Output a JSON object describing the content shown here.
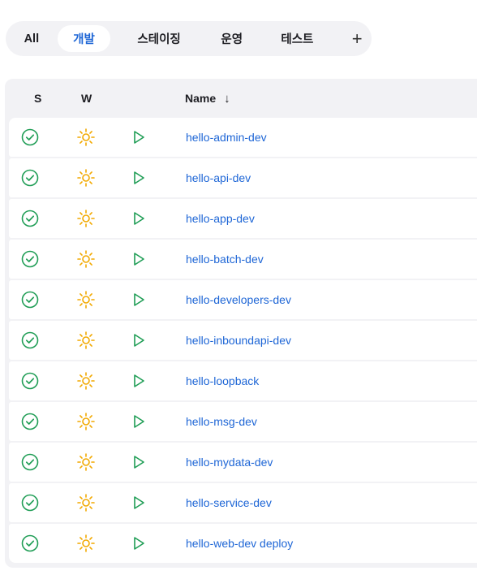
{
  "tabs": [
    {
      "label": "All",
      "active": false
    },
    {
      "label": "개발",
      "active": true
    },
    {
      "label": "스테이징",
      "active": false
    },
    {
      "label": "운영",
      "active": false
    },
    {
      "label": "테스트",
      "active": false
    }
  ],
  "add_tab_label": "+",
  "table": {
    "headers": {
      "status": "S",
      "weather": "W",
      "name": "Name",
      "sort": "↓"
    },
    "rows": [
      {
        "name": "hello-admin-dev",
        "status_icon": "success-check-icon",
        "weather_icon": "sunny-icon"
      },
      {
        "name": "hello-api-dev",
        "status_icon": "success-check-icon",
        "weather_icon": "sunny-icon"
      },
      {
        "name": "hello-app-dev",
        "status_icon": "success-check-icon",
        "weather_icon": "sunny-icon"
      },
      {
        "name": "hello-batch-dev",
        "status_icon": "success-check-icon",
        "weather_icon": "sunny-icon"
      },
      {
        "name": "hello-developers-dev",
        "status_icon": "success-check-icon",
        "weather_icon": "sunny-icon"
      },
      {
        "name": "hello-inboundapi-dev",
        "status_icon": "success-check-icon",
        "weather_icon": "sunny-icon"
      },
      {
        "name": "hello-loopback",
        "status_icon": "success-check-icon",
        "weather_icon": "sunny-icon"
      },
      {
        "name": "hello-msg-dev",
        "status_icon": "success-check-icon",
        "weather_icon": "sunny-icon"
      },
      {
        "name": "hello-mydata-dev",
        "status_icon": "success-check-icon",
        "weather_icon": "sunny-icon"
      },
      {
        "name": "hello-service-dev",
        "status_icon": "success-check-icon",
        "weather_icon": "sunny-icon"
      },
      {
        "name": "hello-web-dev deploy",
        "status_icon": "success-check-icon",
        "weather_icon": "sunny-icon"
      }
    ]
  },
  "colors": {
    "accent": "#1e66d6",
    "success": "#1f9d55",
    "sun": "#f2a900",
    "panel": "#f2f2f5"
  }
}
